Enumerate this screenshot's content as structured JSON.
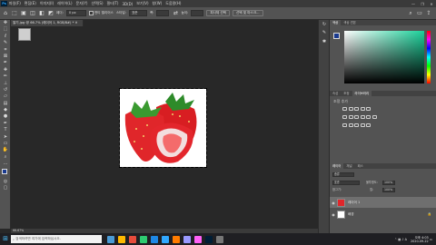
{
  "menubar": {
    "logo": "Ps",
    "items": [
      "파일(F)",
      "편집(E)",
      "이미지(I)",
      "레이어(L)",
      "문자(Y)",
      "선택(S)",
      "필터(T)",
      "3D(D)",
      "보기(V)",
      "창(W)",
      "도움말(H)"
    ],
    "controls": [
      "—",
      "❐",
      "✕"
    ]
  },
  "options": {
    "feather_label": "페더:",
    "feather_value": "0 px",
    "antialias_label": "앤티 앨리어스",
    "style_label": "스타일:",
    "style_value": "표준",
    "width_label": "폭:",
    "height_label": "높이:",
    "select_subject": "피사체 선택",
    "select_mask": "선택 및 마스크..."
  },
  "document": {
    "tab_title": "딸기.jpg @ 66.7% (레이어 1, RGB/8#) * ✕",
    "status": "66.67%"
  },
  "panels": {
    "color_tabs": [
      "색상",
      "색상 견본"
    ],
    "adjust_tabs": [
      "속성",
      "조정",
      "라이브러리"
    ],
    "adjust_title": "조정 추가",
    "layers_tabs": [
      "레이어",
      "채널",
      "패스"
    ],
    "layer_kind": "종류",
    "blend_mode": "표준",
    "opacity_label": "불투명도:",
    "opacity_value": "100%",
    "lock_label": "잠그기:",
    "fill_label": "칠:",
    "fill_value": "100%",
    "layers": [
      {
        "name": "레이어 1",
        "selected": true
      },
      {
        "name": "배경",
        "selected": false
      }
    ]
  },
  "taskbar": {
    "search_placeholder": "검색하려면 여기에 입력하십시오.",
    "time": "오후 4:03",
    "date": "2020-09-22",
    "lang": "A",
    "apps": [
      "#4a9bd6",
      "#ffb900",
      "#e74c3c",
      "#2ecc71",
      "#1e88e5",
      "#31a8ff",
      "#ff7c00",
      "#9999ff",
      "#ff61f6",
      "#001e36",
      "#777"
    ]
  },
  "colors": {
    "accent": "#31a8ff",
    "canvas_bg": "#282828",
    "panel_bg": "#535353"
  }
}
